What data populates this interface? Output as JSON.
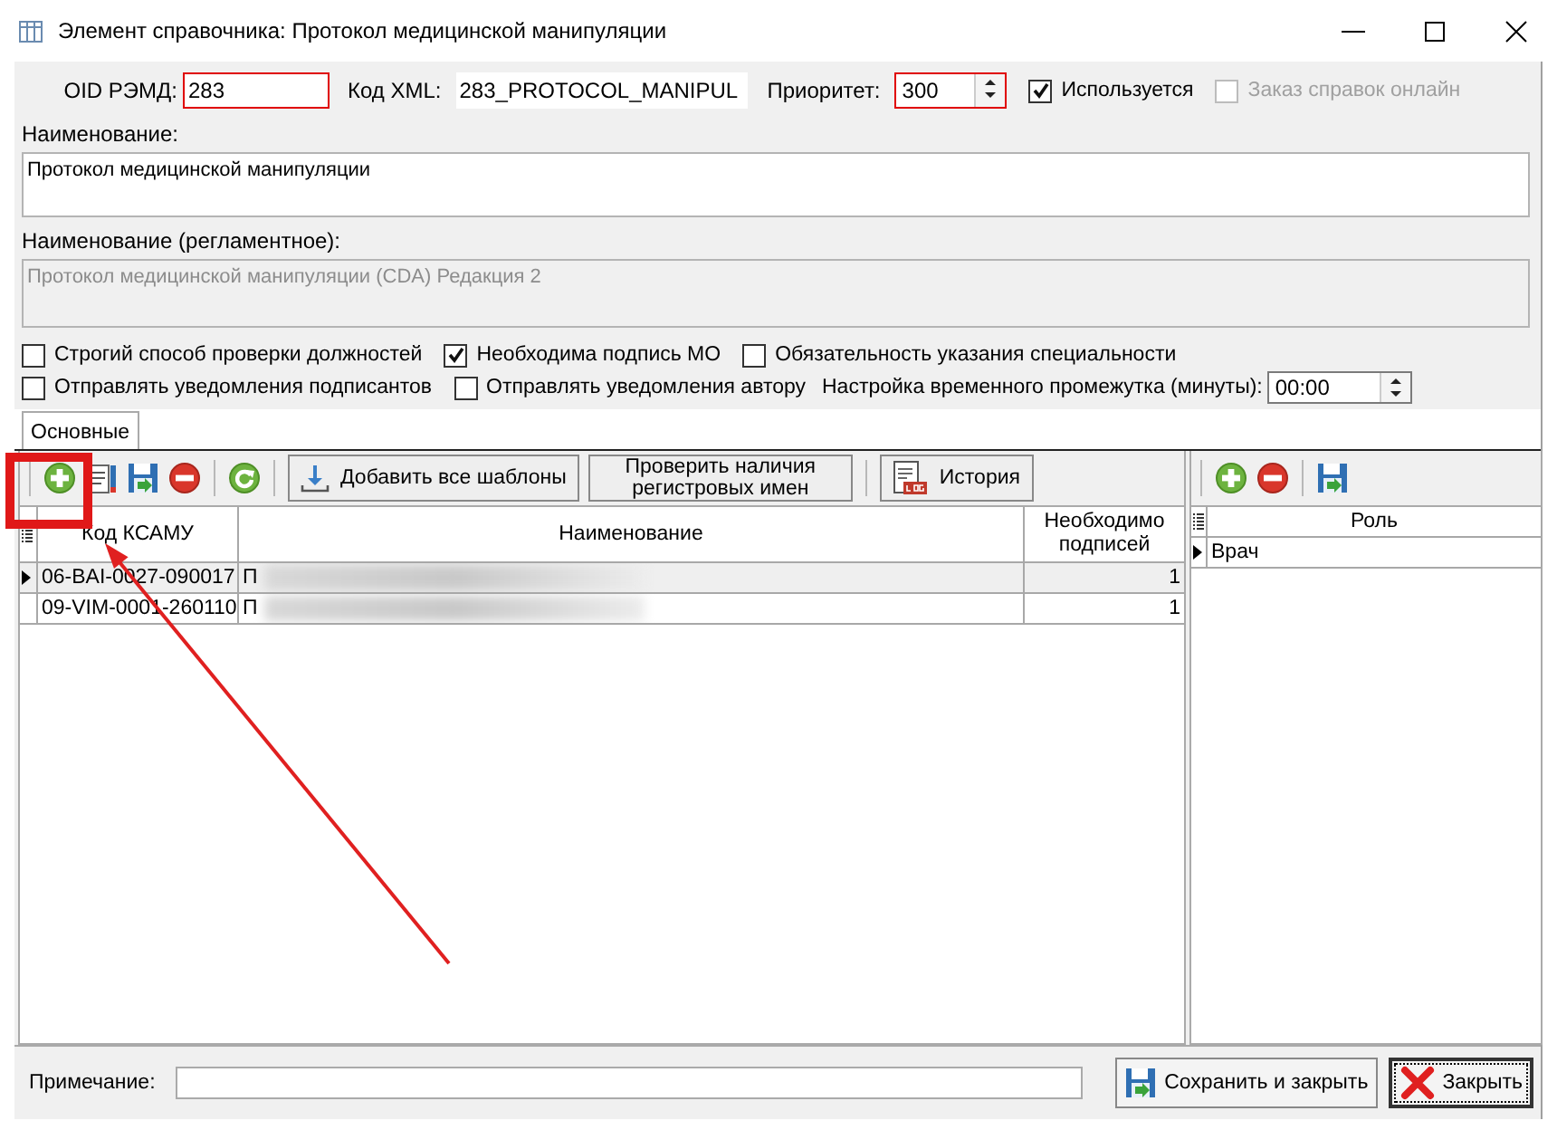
{
  "window": {
    "title": "Элемент справочника: Протокол медицинской манипуляции"
  },
  "fields": {
    "oid": {
      "label": "OID РЭМД:",
      "value": "283",
      "invalid": true
    },
    "xml_code": {
      "label": "Код XML:",
      "value": "283_PROTOCOL_MANIPUL"
    },
    "priority": {
      "label": "Приоритет:",
      "value": "300",
      "invalid": true
    }
  },
  "top_checks": [
    {
      "label": "Используется",
      "checked": true,
      "disabled": false
    },
    {
      "label": "Заказ справок онлайн",
      "checked": false,
      "disabled": true
    }
  ],
  "name": {
    "label": "Наименование:",
    "value": "Протокол медицинской манипуляции"
  },
  "regulated_name": {
    "label": "Наименование (регламентное):",
    "value": "Протокол медицинской манипуляции (CDA) Редакция 2",
    "disabled": true
  },
  "options": [
    {
      "label": "Строгий способ проверки должностей",
      "checked": false
    },
    {
      "label": "Необходима подпись МО",
      "checked": true
    },
    {
      "label": "Обязательность указания специальности",
      "checked": false
    },
    {
      "label": "Отправлять уведомления подписантов",
      "checked": false
    },
    {
      "label": "Отправлять уведомления автору",
      "checked": false
    }
  ],
  "interval": {
    "label": "Настройка временного промежутка (минуты):",
    "value": "00:00"
  },
  "tabs": [
    {
      "label": "Основные",
      "selected": true
    }
  ],
  "toolbar": [
    {
      "kind": "add"
    },
    {
      "kind": "edit"
    },
    {
      "kind": "save"
    },
    {
      "kind": "delete"
    },
    {
      "kind": "separator"
    },
    {
      "kind": "refresh"
    },
    {
      "kind": "separator"
    },
    {
      "kind": "import",
      "label": "Добавить все шаблоны"
    },
    {
      "kind": "check",
      "label": "Проверить наличия регистровых имен"
    },
    {
      "kind": "separator"
    },
    {
      "kind": "history",
      "label": "История"
    }
  ],
  "table": {
    "columns": [
      "Код КСАМУ",
      "Наименование",
      "Необходимо подписей"
    ],
    "rows": [
      {
        "code": "06-BAI-0027-090017",
        "name": "П",
        "signatures": "1",
        "selected": true
      },
      {
        "code": "09-VIM-0001-260110",
        "name": "П",
        "signatures": "1",
        "selected": false
      }
    ]
  },
  "roles_toolbar": [
    {
      "kind": "add"
    },
    {
      "kind": "delete"
    },
    {
      "kind": "separator"
    },
    {
      "kind": "save"
    }
  ],
  "roles_table": {
    "columns": [
      "Роль"
    ],
    "rows": [
      {
        "role": "Врач",
        "selected": true
      }
    ]
  },
  "note": {
    "label": "Примечание:"
  },
  "buttons": [
    {
      "kind": "save",
      "label": "Сохранить и закрыть",
      "default": false
    },
    {
      "kind": "close",
      "label": "Закрыть",
      "default": true
    }
  ],
  "annotations": {
    "highlight_box": true,
    "arrow": true
  }
}
